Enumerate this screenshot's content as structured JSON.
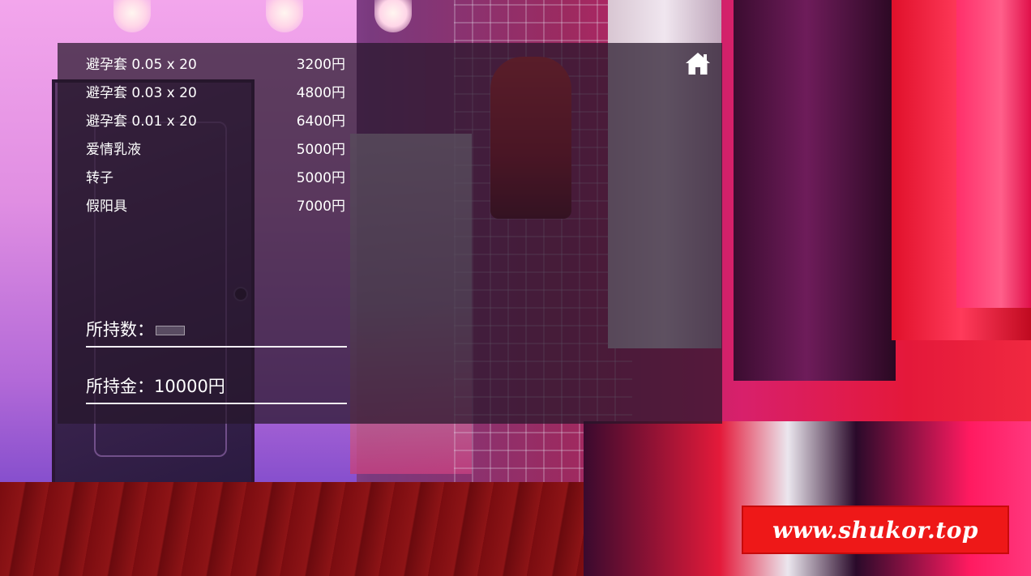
{
  "shop": {
    "items": [
      {
        "name": "避孕套 0.05 x 20",
        "price": "3200円"
      },
      {
        "name": "避孕套 0.03 x 20",
        "price": "4800円"
      },
      {
        "name": "避孕套 0.01 x 20",
        "price": "6400円"
      },
      {
        "name": "爱情乳液",
        "price": "5000円"
      },
      {
        "name": "转子",
        "price": "5000円"
      },
      {
        "name": "假阳具",
        "price": "7000円"
      }
    ],
    "quantity_label": "所持数：",
    "money_label": "所持金：10000円",
    "home_icon": "home-icon"
  },
  "watermark": {
    "text": "www.shukor.top"
  },
  "colors": {
    "panel_bg": "#26162a",
    "text": "#ffffff",
    "watermark_bg": "#ee1818"
  }
}
